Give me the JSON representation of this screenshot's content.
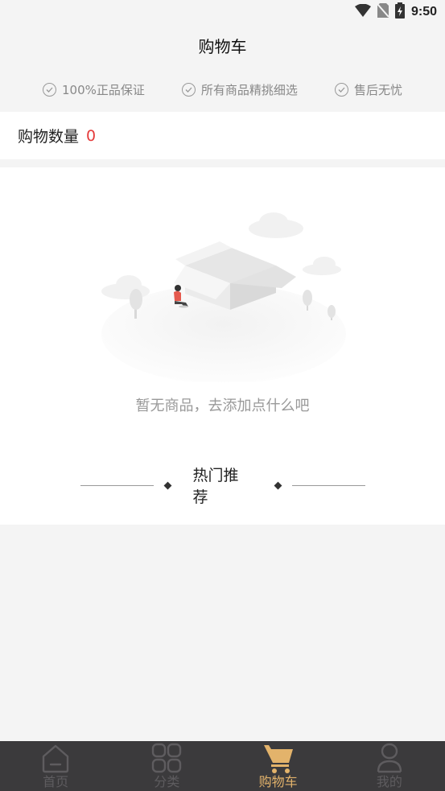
{
  "status_bar": {
    "time": "9:50"
  },
  "header": {
    "title": "购物车"
  },
  "guarantees": [
    {
      "label": "100%正品保证"
    },
    {
      "label": "所有商品精挑细选"
    },
    {
      "label": "售后无忧"
    }
  ],
  "cart": {
    "count_label": "购物数量",
    "count_value": "0"
  },
  "empty": {
    "message": "暂无商品，去添加点什么吧"
  },
  "recommend": {
    "title": "热门推荐"
  },
  "tabs": [
    {
      "label": "首页",
      "icon": "home-icon",
      "active": false
    },
    {
      "label": "分类",
      "icon": "category-icon",
      "active": false
    },
    {
      "label": "购物车",
      "icon": "cart-icon",
      "active": true
    },
    {
      "label": "我的",
      "icon": "profile-icon",
      "active": false
    }
  ],
  "colors": {
    "accent": "#e3b36b",
    "count": "#e53b3b",
    "tab_bg": "#3b3a3c"
  }
}
